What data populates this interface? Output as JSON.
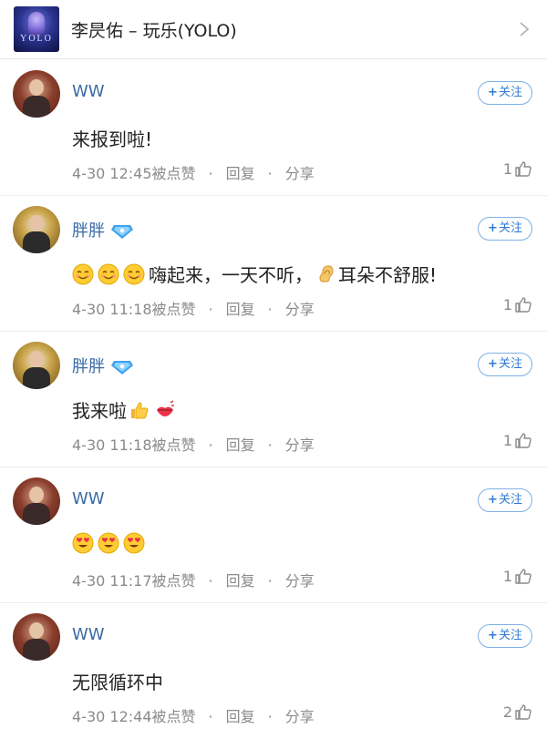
{
  "header": {
    "album_art_text": "YOLO",
    "song_title": "李昃佑 – 玩乐(YOLO)"
  },
  "comments": [
    {
      "username": "WW",
      "vip": false,
      "follow_label": "关注",
      "text_before": "",
      "text": "来报到啦!",
      "timestamp": "4-30 12:45",
      "liked_label": "被点赞",
      "reply_label": "回复",
      "share_label": "分享",
      "likes": "1"
    },
    {
      "username": "胖胖",
      "vip": true,
      "follow_label": "关注",
      "text_a": "嗨起来，一天不听，",
      "text_b": "耳朵不舒服!",
      "timestamp": "4-30 11:18",
      "liked_label": "被点赞",
      "reply_label": "回复",
      "share_label": "分享",
      "likes": "1"
    },
    {
      "username": "胖胖",
      "vip": true,
      "follow_label": "关注",
      "text": "我来啦",
      "timestamp": "4-30 11:18",
      "liked_label": "被点赞",
      "reply_label": "回复",
      "share_label": "分享",
      "likes": "1"
    },
    {
      "username": "WW",
      "vip": false,
      "follow_label": "关注",
      "timestamp": "4-30 11:17",
      "liked_label": "被点赞",
      "reply_label": "回复",
      "share_label": "分享",
      "likes": "1"
    },
    {
      "username": "WW",
      "vip": false,
      "follow_label": "关注",
      "text": "无限循环中",
      "timestamp": "4-30 12:44",
      "liked_label": "被点赞",
      "reply_label": "回复",
      "share_label": "分享",
      "likes": "2"
    }
  ],
  "colors": {
    "username": "#3a6aa6",
    "follow_border": "#7fb0e6",
    "meta": "#8a8a8a"
  }
}
